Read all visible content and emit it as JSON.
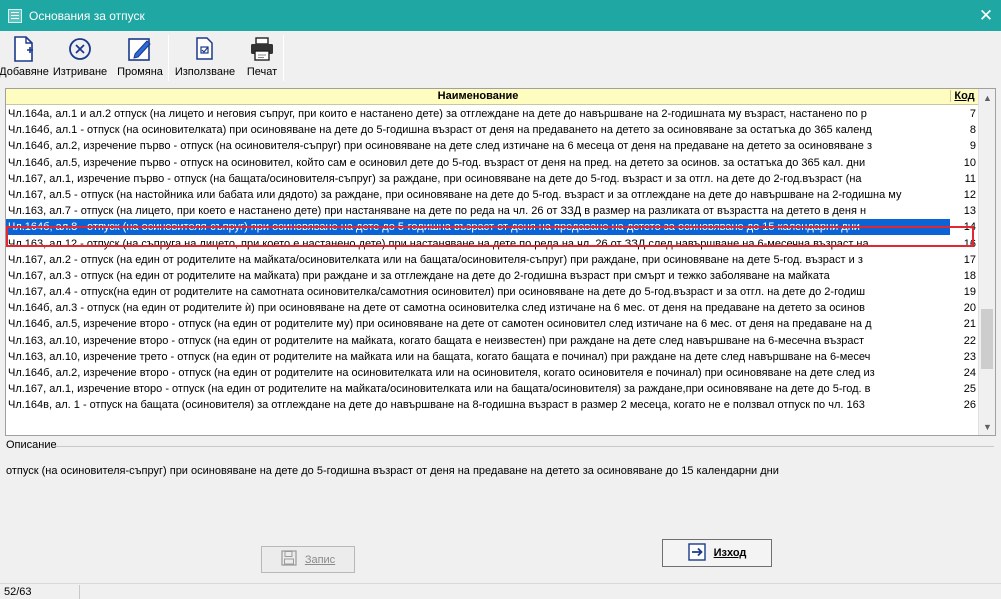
{
  "window": {
    "title": "Основания за отпуск"
  },
  "toolbar": {
    "add": "Добавяне",
    "delete": "Изтриване",
    "edit": "Промяна",
    "use": "Използване",
    "print": "Печат"
  },
  "grid": {
    "col_name": "Наименование",
    "col_code": "Код",
    "rows": [
      {
        "name": "Чл.164а, ал.1 и ал.2 отпуск (на лицето и неговия съпруг, при които е настанено дете) за отглеждане на дете до навършване на 2-годишната му възраст, настанено по р",
        "code": "7"
      },
      {
        "name": "Чл.164б, ал.1 - отпуск (на осиновителката) при осиновяване на дете до 5-годишна възраст от деня на предаването на детето за осиновяване за остатъка до 365 календ",
        "code": "8"
      },
      {
        "name": "Чл.164б, ал.2, изречение първо - отпуск (на осиновителя-съпруг) при осиновяване на дете след изтичане на 6 месеца от деня на предаване на детето за осиновяване з",
        "code": "9"
      },
      {
        "name": "Чл.164б, ал.5, изречение първо - отпуск на осиновител, който сам е осиновил дете до 5-год. възраст от деня на пред. на детето за осинов. за остатъка до 365 кал. дни",
        "code": "10"
      },
      {
        "name": "Чл.167, ал.1, изречение първо - отпуск (на бащата/осиновителя-съпруг) за раждане, при осиновяване на дете до 5-год. възраст и за отгл. на дете до 2-год.възраст (на",
        "code": "11"
      },
      {
        "name": "Чл.167, ал.5 - отпуск (на настойника или бабата или дядото) за раждане, при осиновяване на дете до 5-год. възраст и за отглеждане на дете до навършване на 2-годишна му",
        "code": "12"
      },
      {
        "name": "Чл.163, ал.7 - отпуск (на лицето, при което е настанено дете) при настаняване на дете по реда на чл. 26 от ЗЗД в размер на разликата от възрастта на детето в деня н",
        "code": "13"
      },
      {
        "name": "Чл.164б, ал.8 - отпуск (на осиновителя-съпруг) при осиновяване на дете до 5-годишна възраст от деня на предаване на детето за осиновяване до 15 календарни дни",
        "code": "14",
        "selected": true
      },
      {
        "name": "Чл.163, ал.12 - отпуск (на съпруга на лицето, при което е настанено дете) при настаняване на дете по реда на чл. 26 от ЗЗД след навършване на 6-месечна възраст на",
        "code": "16"
      },
      {
        "name": "Чл.167, ал.2 - отпуск (на един от родителите на майката/осиновителката или на бащата/осиновителя-съпруг) при раждане, при осиновяване на дете 5-год. възраст и з",
        "code": "17"
      },
      {
        "name": "Чл.167, ал.3 - отпуск (на един от родителите на майката) при раждане и за отглеждане на дете до 2-годишна възраст при смърт и тежко заболяване на майката",
        "code": "18"
      },
      {
        "name": "Чл.167, ал.4 - отпуск(на един от родителите на самотната осиновителка/самотния осиновител) при осиновяване на дете до 5-год.възраст и за отгл. на дете до 2-годиш",
        "code": "19"
      },
      {
        "name": "Чл.164б, ал.3 - отпуск (на един от родителите ѝ) при осиновяване на дете от самотна осиновителка след изтичане на 6 мес. от  деня на предаване на детето за осинов",
        "code": "20"
      },
      {
        "name": "Чл.164б, ал.5, изречение второ - отпуск (на един от родителите му) при осиновяване на дете от самотен осиновител след изтичане на 6 мес. от  деня на предаване на д",
        "code": "21"
      },
      {
        "name": "Чл.163, ал.10, изречение второ - отпуск (на един от родителите на майката, когато бащата е неизвестен) при раждане  на дете след навършване на 6-месечна възраст",
        "code": "22"
      },
      {
        "name": "Чл.163, ал.10, изречение трето  - отпуск (на един от родителите на майката или на бащата, когато бащата е починал) при раждане на дете след навършване на 6-месеч",
        "code": "23"
      },
      {
        "name": "Чл.164б, ал.2, изречение второ - отпуск (на един от родителите на осиновителката или на осиновителя, когато осиновителя е починал) при осиновяване на дете след из",
        "code": "24"
      },
      {
        "name": "Чл.167, ал.1, изречение второ - отпуск (на един от родителите на майката/осиновителката или на бащата/осиновителя) за раждане,при осиновяване на дете до 5-год. в",
        "code": "25"
      },
      {
        "name": "Чл.164в, ал. 1 - отпуск на бащата (осиновителя) за отглеждане на дете до навършване на 8-годишна възраст в размер 2 месеца, когато не е ползвал отпуск по чл. 163",
        "code": "26"
      }
    ]
  },
  "description": {
    "label": "Описание",
    "text": "отпуск (на осиновителя-съпруг) при осиновяване на дете до 5-годишна възраст от деня на предаване на детето за осиновяване до 15 календарни дни"
  },
  "buttons": {
    "save": "Запис",
    "exit": "Изход"
  },
  "status": {
    "record": "52/63"
  }
}
